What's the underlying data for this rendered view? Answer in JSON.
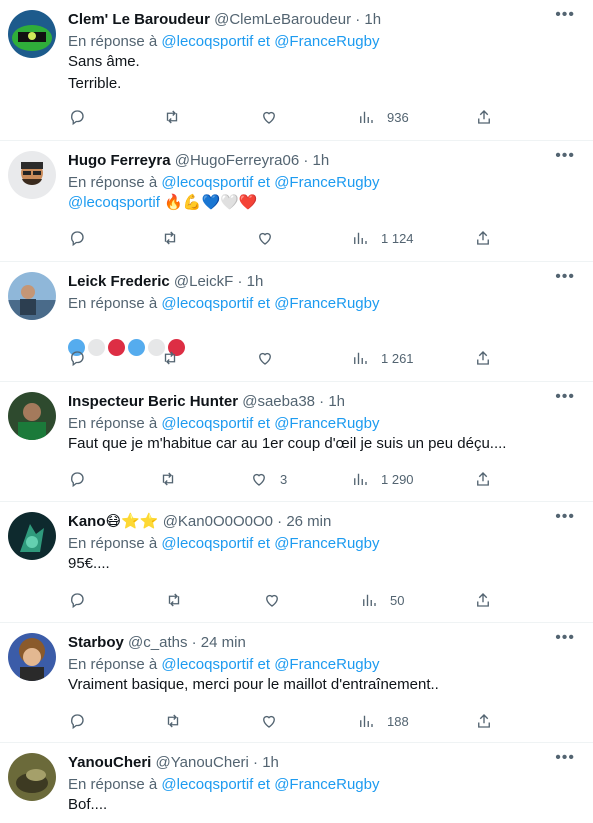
{
  "reply_prefix": "En réponse à",
  "reply_to": [
    "@lecoqsportif",
    "@FranceRugby"
  ],
  "reply_joiner": "et",
  "dot": "·",
  "more_icon": "more-horizontal-icon",
  "colors": {
    "link": "#1d9bf0",
    "muted": "#536471",
    "text": "#0f1419",
    "divider": "#eff3f4"
  },
  "tweets": [
    {
      "name": "Clem' Le Baroudeur",
      "handle": "@ClemLeBaroudeur",
      "time": "1h",
      "lines": [
        "Sans âme.",
        "Terrible."
      ],
      "likes": "",
      "views": "936"
    },
    {
      "name": "Hugo Ferreyra",
      "handle": "@HugoFerreyra06",
      "time": "1h",
      "mention": "@lecoqsportif",
      "emojis": [
        "🔥",
        "💪",
        "💙",
        "🤍",
        "❤️"
      ],
      "likes": "",
      "views": "1 124"
    },
    {
      "name": "Leick Frederic",
      "handle": "@LeickF",
      "time": "1h",
      "dots": [
        "#55acee",
        "#e6e7e8",
        "#dd2e44",
        "#55acee",
        "#e6e7e8",
        "#dd2e44"
      ],
      "likes": "",
      "views": "1 261"
    },
    {
      "name": "Inspecteur Beric Hunter",
      "handle": "@saeba38",
      "time": "1h",
      "lines": [
        "Faut que je m'habitue car au 1er coup d'œil je suis un peu déçu...."
      ],
      "likes": "3",
      "views": "1 290"
    },
    {
      "name": "Kano",
      "name_emojis": [
        "😷",
        "⭐",
        "⭐"
      ],
      "handle": "@Kan0O0O0O0",
      "time": "26 min",
      "lines": [
        "95€...."
      ],
      "likes": "",
      "views": "50"
    },
    {
      "name": "Starboy",
      "handle": "@c_aths",
      "time": "24 min",
      "lines": [
        "Vraiment basique, merci pour le maillot d'entraînement.."
      ],
      "likes": "",
      "views": "188"
    },
    {
      "name": "YanouCheri",
      "handle": "@YanouCheri",
      "time": "1h",
      "lines": [
        "Bof...."
      ],
      "likes": "",
      "views": ""
    }
  ]
}
